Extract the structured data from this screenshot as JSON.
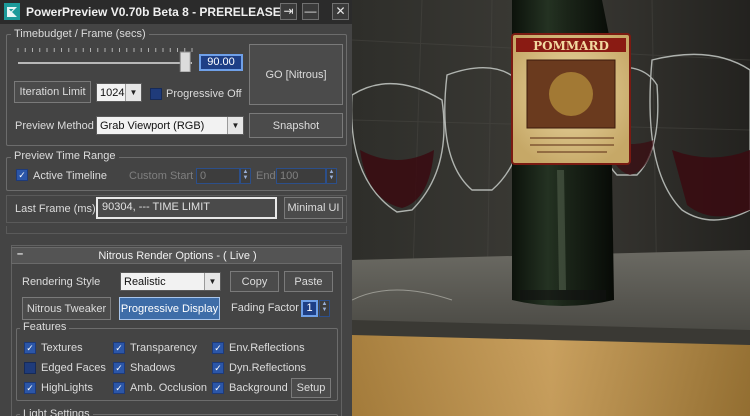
{
  "window": {
    "title": "PowerPreview V0.70b Beta 8 - PRERELEASE",
    "buttons": {
      "dock": "⇥",
      "minimize": "—",
      "close": "✕"
    }
  },
  "timebudget": {
    "legend": "Timebudget / Frame (secs)",
    "value": "90.00",
    "slider_fraction": 0.99,
    "go_button": "GO [Nitrous]",
    "iteration_limit_button": "Iteration Limit",
    "iteration_value": "1024",
    "progressive_off_label": "Progressive Off",
    "progressive_off_checked": false,
    "preview_method_label": "Preview Method",
    "preview_method_value": "Grab Viewport (RGB)",
    "snapshot_button": "Snapshot"
  },
  "time_range": {
    "legend": "Preview Time Range",
    "active_timeline_label": "Active Timeline",
    "active_timeline_checked": true,
    "custom_start_label": "Custom Start",
    "custom_start_value": "0",
    "end_label": "End",
    "end_value": "100"
  },
  "last_frame": {
    "label": "Last Frame (ms)",
    "value": "90304,  --- TIME LIMIT",
    "minimal_ui_button": "Minimal UI"
  },
  "nitrous": {
    "rollout_toggle": "–",
    "rollout_title": "Nitrous Render Options - ( Live )",
    "rendering_style_label": "Rendering Style",
    "rendering_style_value": "Realistic",
    "copy_button": "Copy",
    "paste_button": "Paste",
    "tweaker_button": "Nitrous Tweaker",
    "progressive_display_button": "Progressive Display",
    "fading_factor_label": "Fading Factor",
    "fading_factor_value": "1",
    "features_legend": "Features",
    "features": [
      {
        "label": "Textures",
        "checked": true
      },
      {
        "label": "Transparency",
        "checked": true
      },
      {
        "label": "Env.Reflections",
        "checked": true
      },
      {
        "label": "Edged Faces",
        "checked": false
      },
      {
        "label": "Shadows",
        "checked": true
      },
      {
        "label": "Dyn.Reflections",
        "checked": true
      },
      {
        "label": "HighLights",
        "checked": true
      },
      {
        "label": "Amb. Occlusion",
        "checked": true
      },
      {
        "label": "Background",
        "checked": true
      }
    ],
    "setup_button": "Setup",
    "light_settings_legend": "Light Settings"
  },
  "viewport": {
    "label_text": "POMMARD"
  },
  "colors": {
    "panel_bg": "#444444",
    "accent_blue": "#3e6da8",
    "checkbox_blue": "#2b56a8",
    "value_field_border": "#6fa0e8"
  },
  "icons": [
    "app-3dsmax-icon",
    "dock-icon",
    "minimize-icon",
    "close-icon",
    "dropdown-arrow-icon",
    "spinner-arrows-icon",
    "checkmark-icon"
  ]
}
